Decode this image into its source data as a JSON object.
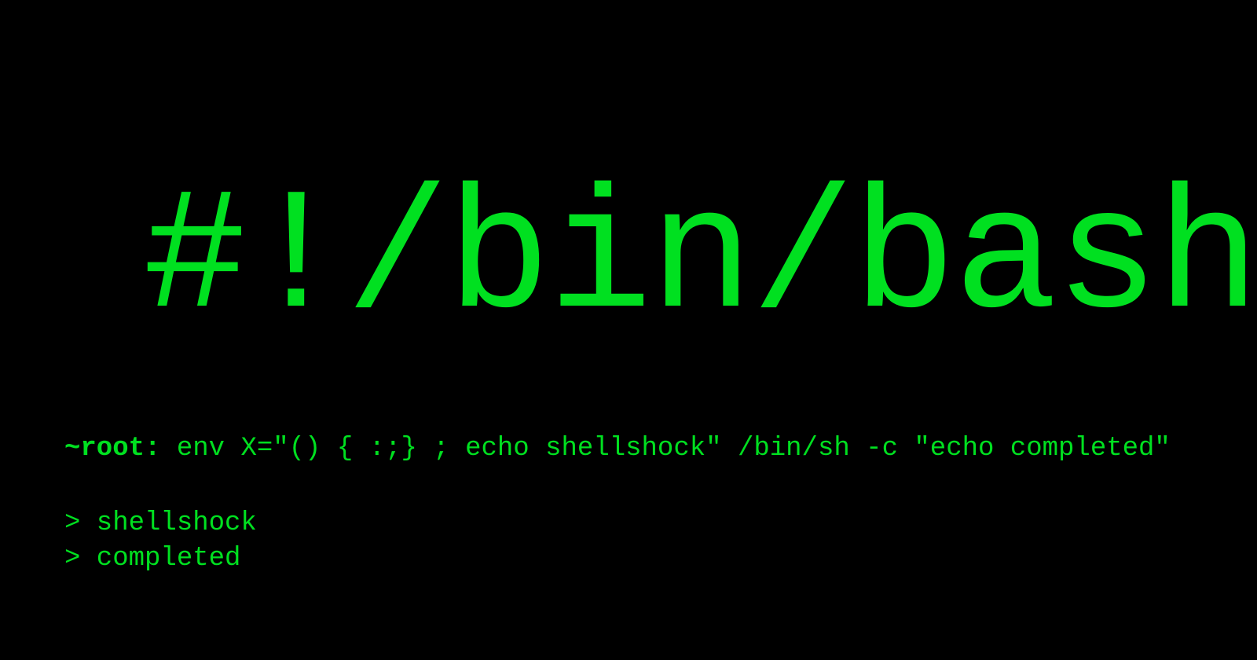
{
  "terminal": {
    "shebang": "#!/bin/bash",
    "prompt": "~root:",
    "command": "env X=\"() { :;} ; echo shellshock\" /bin/sh -c \"echo completed\"",
    "output": [
      "> shellshock",
      "> completed"
    ]
  },
  "colors": {
    "background": "#000000",
    "text": "#00e020"
  }
}
